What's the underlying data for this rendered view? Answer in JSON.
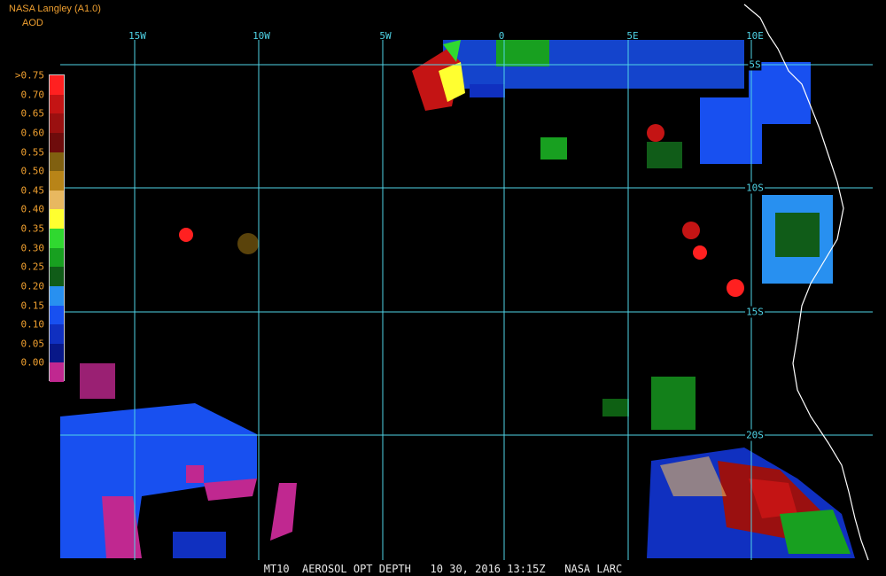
{
  "header": {
    "source": "NASA Langley (A1.0)",
    "variable": "AOD"
  },
  "longitude_labels": [
    "15W",
    "10W",
    "5W",
    "0",
    "5E",
    "10E"
  ],
  "latitude_labels": [
    "5S",
    "10S",
    "15S",
    "20S"
  ],
  "legend": {
    "labels": [
      ">0.75",
      "0.70",
      "0.65",
      "0.60",
      "0.55",
      "0.50",
      "0.45",
      "0.40",
      "0.35",
      "0.30",
      "0.25",
      "0.20",
      "0.15",
      "0.10",
      "0.05",
      "0.00"
    ],
    "colors": [
      "#ff2020",
      "#c41414",
      "#9a1010",
      "#6e0c0c",
      "#806010",
      "#b88418",
      "#e8b860",
      "#ffff30",
      "#30d830",
      "#18a020",
      "#105c18",
      "#2890f0",
      "#1850f0",
      "#1030c0",
      "#081888",
      "#c02890"
    ]
  },
  "footer": "MT10  AEROSOL OPT DEPTH   10 30, 2016 13:15Z   NASA LARC",
  "colors": {
    "grid": "#4fd3e6",
    "coast": "#ffffff",
    "label": "#f0a030",
    "background": "#000000"
  }
}
